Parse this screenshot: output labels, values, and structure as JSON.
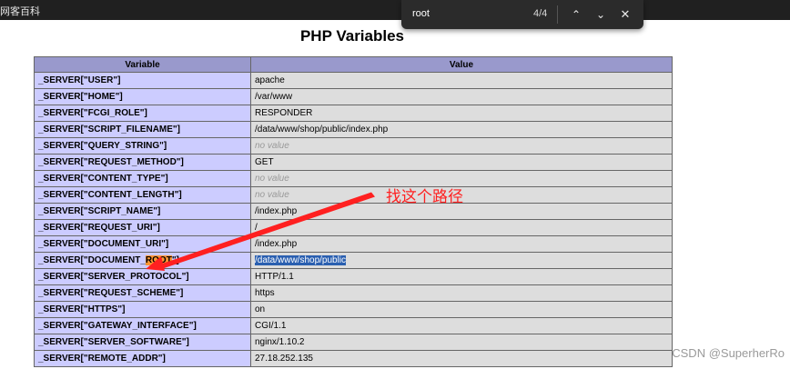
{
  "browser": {
    "tab_title": "网客百科"
  },
  "find_bar": {
    "query": "root",
    "match_count": "4/4"
  },
  "page": {
    "title": "PHP Variables",
    "columns": [
      "Variable",
      "Value"
    ],
    "rows": [
      {
        "variable": "_SERVER[\"USER\"]",
        "value": "apache"
      },
      {
        "variable": "_SERVER[\"HOME\"]",
        "value": "/var/www"
      },
      {
        "variable": "_SERVER[\"FCGI_ROLE\"]",
        "value": "RESPONDER"
      },
      {
        "variable": "_SERVER[\"SCRIPT_FILENAME\"]",
        "value": "/data/www/shop/public/index.php"
      },
      {
        "variable": "_SERVER[\"QUERY_STRING\"]",
        "value": "no value"
      },
      {
        "variable": "_SERVER[\"REQUEST_METHOD\"]",
        "value": "GET"
      },
      {
        "variable": "_SERVER[\"CONTENT_TYPE\"]",
        "value": "no value"
      },
      {
        "variable": "_SERVER[\"CONTENT_LENGTH\"]",
        "value": "no value"
      },
      {
        "variable": "_SERVER[\"SCRIPT_NAME\"]",
        "value": "/index.php"
      },
      {
        "variable": "_SERVER[\"REQUEST_URI\"]",
        "value": "/"
      },
      {
        "variable": "_SERVER[\"DOCUMENT_URI\"]",
        "value": "/index.php"
      },
      {
        "variable": "_SERVER[\"DOCUMENT_ROOT\"]",
        "value": "/data/www/shop/public"
      },
      {
        "variable": "_SERVER[\"SERVER_PROTOCOL\"]",
        "value": "HTTP/1.1"
      },
      {
        "variable": "_SERVER[\"REQUEST_SCHEME\"]",
        "value": "https"
      },
      {
        "variable": "_SERVER[\"HTTPS\"]",
        "value": "on"
      },
      {
        "variable": "_SERVER[\"GATEWAY_INTERFACE\"]",
        "value": "CGI/1.1"
      },
      {
        "variable": "_SERVER[\"SERVER_SOFTWARE\"]",
        "value": "nginx/1.10.2"
      },
      {
        "variable": "_SERVER[\"REMOTE_ADDR\"]",
        "value": "27.18.252.135"
      }
    ]
  },
  "annotation": {
    "text": "找这个路径",
    "color": "#ff2020"
  },
  "watermark": {
    "text": "CSDN @SuperherRo"
  },
  "colors": {
    "header_bg": "#9999cc",
    "variable_cell_bg": "#ccccff",
    "value_cell_bg": "#dddddd",
    "find_highlight": "#ff9632",
    "selection": "#2a5fb0"
  }
}
